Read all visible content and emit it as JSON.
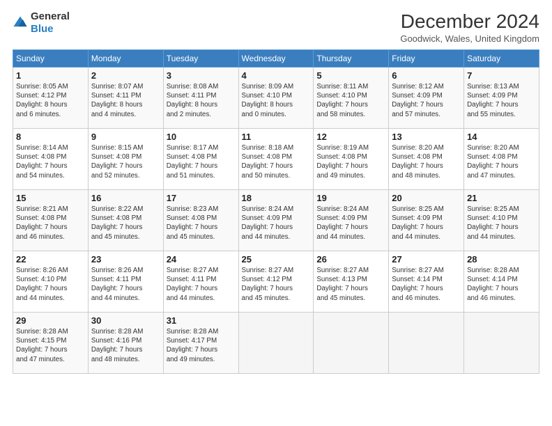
{
  "header": {
    "logo_general": "General",
    "logo_blue": "Blue",
    "title": "December 2024",
    "location": "Goodwick, Wales, United Kingdom"
  },
  "columns": [
    "Sunday",
    "Monday",
    "Tuesday",
    "Wednesday",
    "Thursday",
    "Friday",
    "Saturday"
  ],
  "weeks": [
    [
      {
        "day": "1",
        "lines": [
          "Sunrise: 8:05 AM",
          "Sunset: 4:12 PM",
          "Daylight: 8 hours",
          "and 6 minutes."
        ]
      },
      {
        "day": "2",
        "lines": [
          "Sunrise: 8:07 AM",
          "Sunset: 4:11 PM",
          "Daylight: 8 hours",
          "and 4 minutes."
        ]
      },
      {
        "day": "3",
        "lines": [
          "Sunrise: 8:08 AM",
          "Sunset: 4:11 PM",
          "Daylight: 8 hours",
          "and 2 minutes."
        ]
      },
      {
        "day": "4",
        "lines": [
          "Sunrise: 8:09 AM",
          "Sunset: 4:10 PM",
          "Daylight: 8 hours",
          "and 0 minutes."
        ]
      },
      {
        "day": "5",
        "lines": [
          "Sunrise: 8:11 AM",
          "Sunset: 4:10 PM",
          "Daylight: 7 hours",
          "and 58 minutes."
        ]
      },
      {
        "day": "6",
        "lines": [
          "Sunrise: 8:12 AM",
          "Sunset: 4:09 PM",
          "Daylight: 7 hours",
          "and 57 minutes."
        ]
      },
      {
        "day": "7",
        "lines": [
          "Sunrise: 8:13 AM",
          "Sunset: 4:09 PM",
          "Daylight: 7 hours",
          "and 55 minutes."
        ]
      }
    ],
    [
      {
        "day": "8",
        "lines": [
          "Sunrise: 8:14 AM",
          "Sunset: 4:08 PM",
          "Daylight: 7 hours",
          "and 54 minutes."
        ]
      },
      {
        "day": "9",
        "lines": [
          "Sunrise: 8:15 AM",
          "Sunset: 4:08 PM",
          "Daylight: 7 hours",
          "and 52 minutes."
        ]
      },
      {
        "day": "10",
        "lines": [
          "Sunrise: 8:17 AM",
          "Sunset: 4:08 PM",
          "Daylight: 7 hours",
          "and 51 minutes."
        ]
      },
      {
        "day": "11",
        "lines": [
          "Sunrise: 8:18 AM",
          "Sunset: 4:08 PM",
          "Daylight: 7 hours",
          "and 50 minutes."
        ]
      },
      {
        "day": "12",
        "lines": [
          "Sunrise: 8:19 AM",
          "Sunset: 4:08 PM",
          "Daylight: 7 hours",
          "and 49 minutes."
        ]
      },
      {
        "day": "13",
        "lines": [
          "Sunrise: 8:20 AM",
          "Sunset: 4:08 PM",
          "Daylight: 7 hours",
          "and 48 minutes."
        ]
      },
      {
        "day": "14",
        "lines": [
          "Sunrise: 8:20 AM",
          "Sunset: 4:08 PM",
          "Daylight: 7 hours",
          "and 47 minutes."
        ]
      }
    ],
    [
      {
        "day": "15",
        "lines": [
          "Sunrise: 8:21 AM",
          "Sunset: 4:08 PM",
          "Daylight: 7 hours",
          "and 46 minutes."
        ]
      },
      {
        "day": "16",
        "lines": [
          "Sunrise: 8:22 AM",
          "Sunset: 4:08 PM",
          "Daylight: 7 hours",
          "and 45 minutes."
        ]
      },
      {
        "day": "17",
        "lines": [
          "Sunrise: 8:23 AM",
          "Sunset: 4:08 PM",
          "Daylight: 7 hours",
          "and 45 minutes."
        ]
      },
      {
        "day": "18",
        "lines": [
          "Sunrise: 8:24 AM",
          "Sunset: 4:09 PM",
          "Daylight: 7 hours",
          "and 44 minutes."
        ]
      },
      {
        "day": "19",
        "lines": [
          "Sunrise: 8:24 AM",
          "Sunset: 4:09 PM",
          "Daylight: 7 hours",
          "and 44 minutes."
        ]
      },
      {
        "day": "20",
        "lines": [
          "Sunrise: 8:25 AM",
          "Sunset: 4:09 PM",
          "Daylight: 7 hours",
          "and 44 minutes."
        ]
      },
      {
        "day": "21",
        "lines": [
          "Sunrise: 8:25 AM",
          "Sunset: 4:10 PM",
          "Daylight: 7 hours",
          "and 44 minutes."
        ]
      }
    ],
    [
      {
        "day": "22",
        "lines": [
          "Sunrise: 8:26 AM",
          "Sunset: 4:10 PM",
          "Daylight: 7 hours",
          "and 44 minutes."
        ]
      },
      {
        "day": "23",
        "lines": [
          "Sunrise: 8:26 AM",
          "Sunset: 4:11 PM",
          "Daylight: 7 hours",
          "and 44 minutes."
        ]
      },
      {
        "day": "24",
        "lines": [
          "Sunrise: 8:27 AM",
          "Sunset: 4:11 PM",
          "Daylight: 7 hours",
          "and 44 minutes."
        ]
      },
      {
        "day": "25",
        "lines": [
          "Sunrise: 8:27 AM",
          "Sunset: 4:12 PM",
          "Daylight: 7 hours",
          "and 45 minutes."
        ]
      },
      {
        "day": "26",
        "lines": [
          "Sunrise: 8:27 AM",
          "Sunset: 4:13 PM",
          "Daylight: 7 hours",
          "and 45 minutes."
        ]
      },
      {
        "day": "27",
        "lines": [
          "Sunrise: 8:27 AM",
          "Sunset: 4:14 PM",
          "Daylight: 7 hours",
          "and 46 minutes."
        ]
      },
      {
        "day": "28",
        "lines": [
          "Sunrise: 8:28 AM",
          "Sunset: 4:14 PM",
          "Daylight: 7 hours",
          "and 46 minutes."
        ]
      }
    ],
    [
      {
        "day": "29",
        "lines": [
          "Sunrise: 8:28 AM",
          "Sunset: 4:15 PM",
          "Daylight: 7 hours",
          "and 47 minutes."
        ]
      },
      {
        "day": "30",
        "lines": [
          "Sunrise: 8:28 AM",
          "Sunset: 4:16 PM",
          "Daylight: 7 hours",
          "and 48 minutes."
        ]
      },
      {
        "day": "31",
        "lines": [
          "Sunrise: 8:28 AM",
          "Sunset: 4:17 PM",
          "Daylight: 7 hours",
          "and 49 minutes."
        ]
      },
      {
        "day": "",
        "lines": []
      },
      {
        "day": "",
        "lines": []
      },
      {
        "day": "",
        "lines": []
      },
      {
        "day": "",
        "lines": []
      }
    ]
  ]
}
